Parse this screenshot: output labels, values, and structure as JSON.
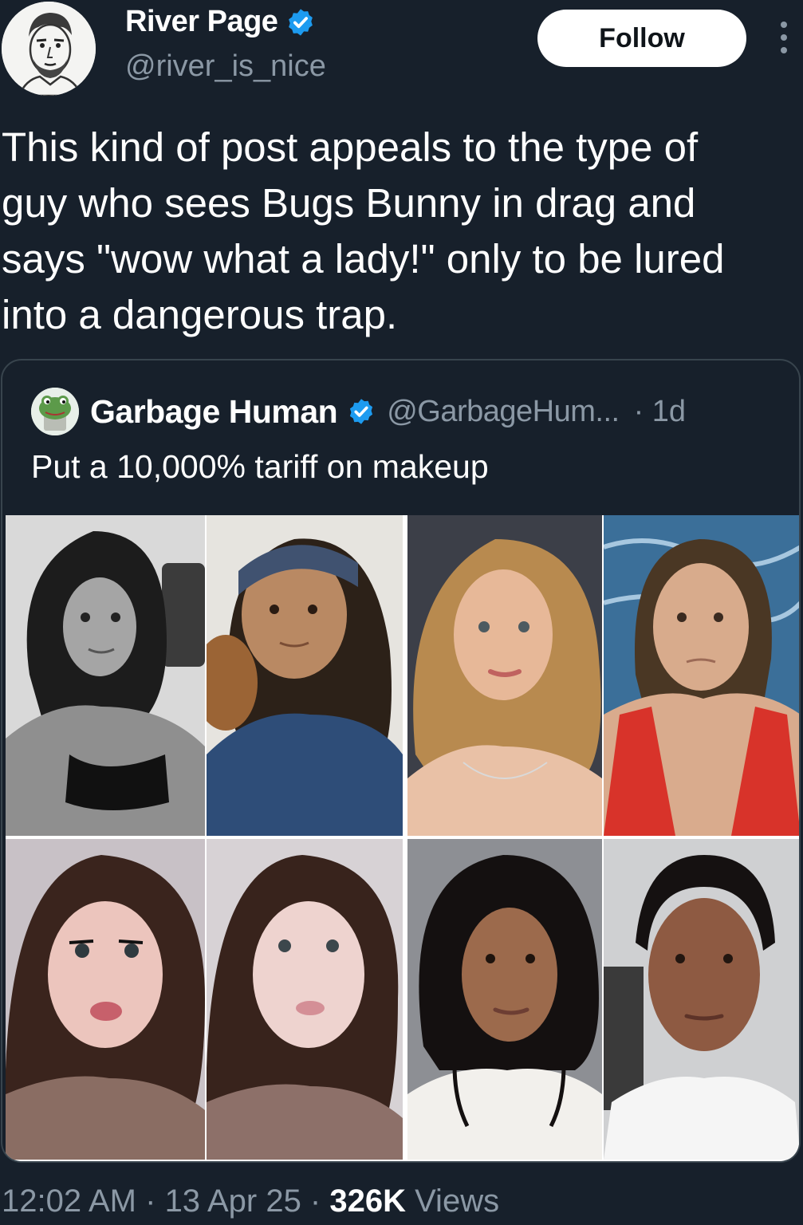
{
  "author": {
    "display_name": "River Page",
    "handle": "@river_is_nice",
    "verified_icon": "verified-badge-icon",
    "avatar_icon": "sketch-portrait-avatar"
  },
  "follow_label": "Follow",
  "more_icon": "more-vertical-icon",
  "tweet_text": "This kind of post appeals to the type of\nguy who sees Bugs Bunny in drag and\nsays \"wow what a lady!\" only to be lured\ninto a dangerous trap.",
  "quoted": {
    "display_name": "Garbage Human",
    "handle": "@GarbageHum...",
    "time": "· 1d",
    "text": "Put a 10,000% tariff on makeup",
    "avatar_icon": "frog-avatar",
    "photos": [
      "grayscale-mirror-selfie-with-makeup",
      "headband-no-makeup-with-dog",
      "blonde-bob-glam-makeup",
      "red-swimsuit-no-makeup-at-sea",
      "dark-hair-glam-makeup-selfie",
      "dark-hair-no-makeup-selfie",
      "curly-updo-glam-makeup",
      "no-makeup-white-shirt"
    ]
  },
  "footer": {
    "time": "12:02 AM",
    "sep1": " · ",
    "date": "13 Apr 25",
    "sep2": " · ",
    "views_count": "326K",
    "views_label": " Views"
  },
  "colors": {
    "background": "#17202b",
    "text": "#ffffff",
    "secondary_text": "#8b98a5",
    "verified": "#1d9bf0",
    "border": "#38444d"
  }
}
